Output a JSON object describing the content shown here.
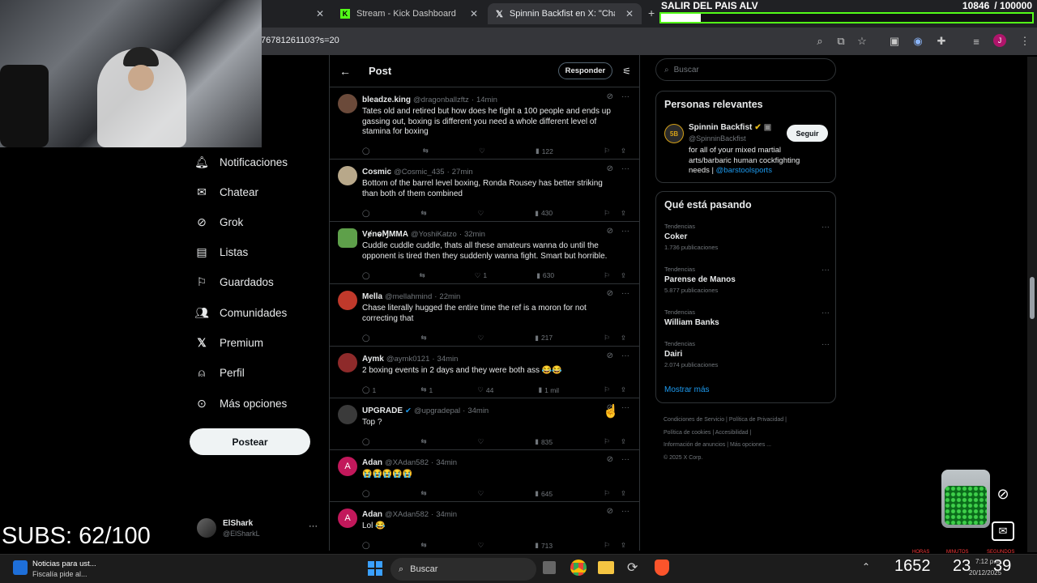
{
  "browser": {
    "tabs": [
      {
        "label": "Stream - Kick Dashboard",
        "icon": "kick-icon"
      },
      {
        "label": "Spinnin Backfist en X: \"Chase D",
        "icon": "x-logo-icon"
      }
    ],
    "url": "76781261103?s=20",
    "profile_initial": "J"
  },
  "overlay": {
    "goal_title": "SALIR DEL PAIS ALV",
    "goal_count": "10846",
    "goal_total": "/ 100000",
    "subs": "SUBS: 62/100",
    "timer": {
      "hours": "1652",
      "minutes": "23",
      "seconds": "39",
      "hours_label": "HORAS",
      "minutes_label": "MINUTOS",
      "seconds_label": "SEGUNDOS"
    }
  },
  "sidebar": {
    "items": [
      {
        "label": "Notificaciones",
        "icon": "bell-icon"
      },
      {
        "label": "Chatear",
        "icon": "mail-icon"
      },
      {
        "label": "Grok",
        "icon": "grok-icon"
      },
      {
        "label": "Listas",
        "icon": "list-icon"
      },
      {
        "label": "Guardados",
        "icon": "bookmark-icon"
      },
      {
        "label": "Comunidades",
        "icon": "people-icon"
      },
      {
        "label": "Premium",
        "icon": "x-logo-icon"
      },
      {
        "label": "Perfil",
        "icon": "person-icon"
      },
      {
        "label": "Más opciones",
        "icon": "more-circle-icon"
      }
    ],
    "post_button": "Postear",
    "account": {
      "name": "ElShark",
      "handle": "@ElSharkL"
    }
  },
  "main": {
    "title": "Post",
    "reply_button": "Responder",
    "replies": [
      {
        "name": "bleadze.king",
        "handle": "@dragonballzftz",
        "time": "14min",
        "text": "Tates old and retired but how does he fight a 100 people and ends up gassing out, boxing is different you need a whole different level of stamina for boxing",
        "replies": "",
        "reposts": "",
        "likes": "",
        "views": "122",
        "avatar_color": "#6b4a3a"
      },
      {
        "name": "Cosmic",
        "handle": "@Cosmic_435",
        "time": "27min",
        "text": "Bottom of the barrel level boxing, Ronda Rousey has better striking than both of them combined",
        "replies": "",
        "reposts": "",
        "likes": "",
        "views": "430",
        "avatar_color": "#b8a88a"
      },
      {
        "name": "VɇnⱺⱮMMA",
        "handle": "@YoshiKatzo",
        "time": "32min",
        "text": "Cuddle cuddle cuddle, thats all these amateurs wanna do until the opponent is tired then they suddenly wanna fight. Smart but horrible.",
        "replies": "",
        "reposts": "",
        "likes": "1",
        "views": "630",
        "avatar_color": "#5ea04a"
      },
      {
        "name": "Mella",
        "handle": "@mellahmind",
        "time": "22min",
        "text": "Chase literally hugged the entire time the ref is a moron for not correcting that",
        "replies": "",
        "reposts": "",
        "likes": "",
        "views": "217",
        "avatar_color": "#c0392b"
      },
      {
        "name": "Aymk",
        "handle": "@aymk0121",
        "time": "34min",
        "text": "2 boxing events in 2 days and they were both ass 😂😂",
        "replies": "1",
        "reposts": "1",
        "likes": "44",
        "views": "1 mil",
        "avatar_color": "#8e2a2a"
      },
      {
        "name": "UPGRADE",
        "handle": "@upgradepal",
        "time": "34min",
        "text": "Top ?",
        "replies": "",
        "reposts": "",
        "likes": "",
        "views": "835",
        "avatar_color": "#3a3a3a"
      },
      {
        "name": "Adan",
        "handle": "@XAdan582",
        "time": "34min",
        "text": "😭😭😭😭😭",
        "replies": "",
        "reposts": "",
        "likes": "",
        "views": "645",
        "avatar_color": "#c2185b",
        "initial": "A"
      },
      {
        "name": "Adan",
        "handle": "@XAdan582",
        "time": "34min",
        "text": "Lol 😂",
        "replies": "",
        "reposts": "",
        "likes": "",
        "views": "713",
        "avatar_color": "#c2185b",
        "initial": "A"
      }
    ]
  },
  "right": {
    "search_placeholder": "Buscar",
    "relevant": {
      "title": "Personas relevantes",
      "name": "Spinnin Backfist",
      "handle": "@SpinninBackfist",
      "follow": "Seguir",
      "bio": "for all of your mixed martial arts/barbaric human cockfighting needs | ",
      "bio_link": "@barstoolsports"
    },
    "trends": {
      "title": "Qué está pasando",
      "items": [
        {
          "context": "Tendencias",
          "name": "Coker",
          "count": "1.736 publicaciones"
        },
        {
          "context": "Tendencias",
          "name": "Parense de Manos",
          "count": "5.877 publicaciones"
        },
        {
          "context": "Tendencias",
          "name": "William Banks",
          "count": ""
        },
        {
          "context": "Tendencias",
          "name": "Dairi",
          "count": "2.074 publicaciones"
        }
      ],
      "show_more": "Mostrar más"
    },
    "footer": [
      "Condiciones de Servicio",
      "Política de Privacidad",
      "Política de cookies",
      "Accesibilidad",
      "Información de anuncios",
      "Más opciones ...",
      "© 2025 X Corp."
    ]
  },
  "taskbar": {
    "news_title": "Noticias para ust...",
    "news_sub": "Fiscalía pide al...",
    "search": "Buscar",
    "lang": "ESP\nLAA",
    "time": "7:12 p.m.",
    "date": "20/12/2025"
  }
}
